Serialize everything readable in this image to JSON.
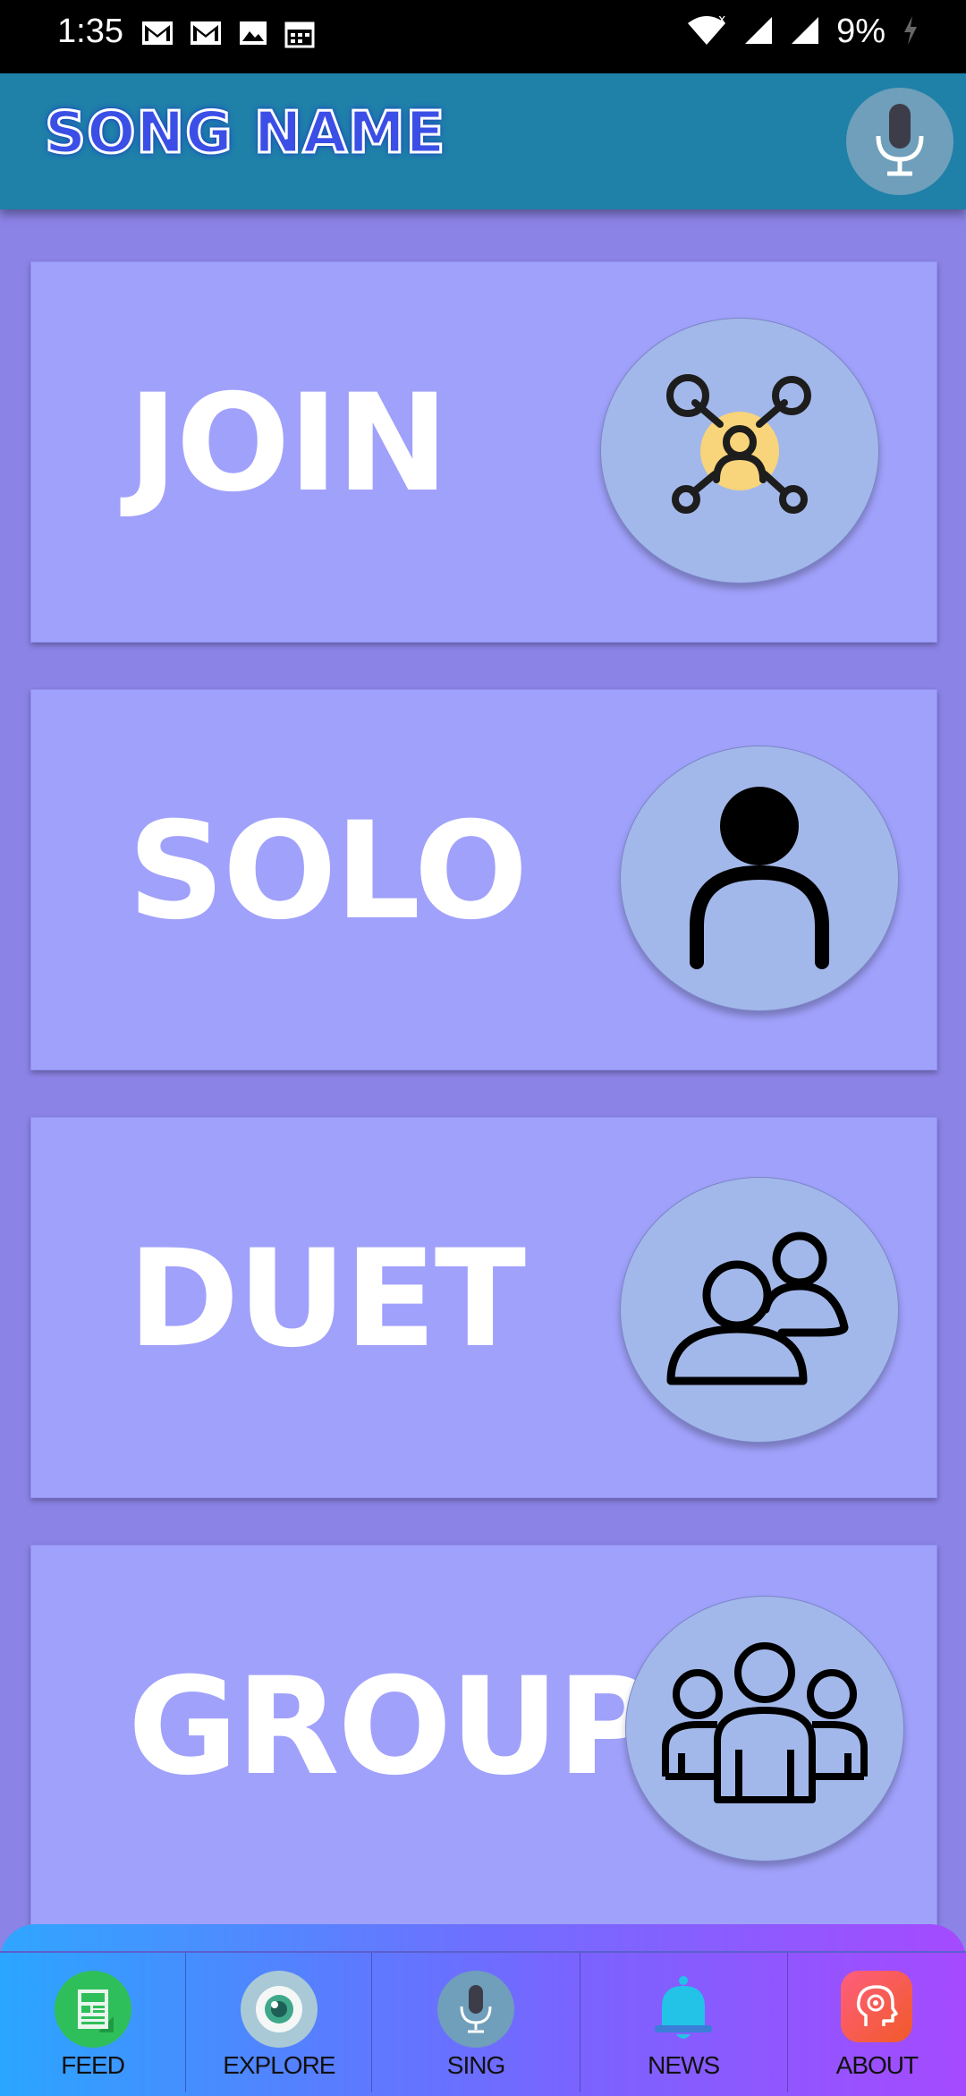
{
  "status_bar": {
    "time": "1:35",
    "battery": "9%",
    "icons": [
      "gmail-icon",
      "gmail-icon",
      "image-icon",
      "calendar-icon",
      "wifi-icon",
      "signal-icon",
      "signal-icon",
      "charging-icon"
    ]
  },
  "app_bar": {
    "title": "SONG NAME",
    "mic_icon": "microphone-icon"
  },
  "modes": [
    {
      "label": "JOIN",
      "icon": "network-join-icon"
    },
    {
      "label": "SOLO",
      "icon": "single-person-icon"
    },
    {
      "label": "DUET",
      "icon": "two-people-icon"
    },
    {
      "label": "GROUP",
      "icon": "group-people-icon"
    }
  ],
  "bottom_nav": [
    {
      "label": "FEED",
      "icon": "feed-icon",
      "color": "#2fbf5a"
    },
    {
      "label": "EXPLORE",
      "icon": "eye-icon",
      "color": "#a9c9d6"
    },
    {
      "label": "SING",
      "icon": "microphone-icon",
      "color": "#6f9fba"
    },
    {
      "label": "NEWS",
      "icon": "bell-icon",
      "color": "#22c3e6"
    },
    {
      "label": "ABOUT",
      "icon": "brain-gear-icon",
      "color": "#f0405a"
    }
  ],
  "colors": {
    "background": "#8b83e6",
    "card": "#a0a1fb",
    "app_bar": "#1f80a8",
    "circle": "#a3b8ea"
  }
}
